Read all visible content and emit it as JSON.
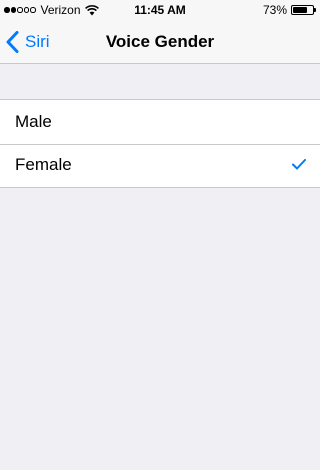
{
  "status_bar": {
    "carrier": "Verizon",
    "time": "11:45 AM",
    "battery_percent": "73%",
    "battery_level": 0.73,
    "signal_bars_filled": 2,
    "signal_bars_total": 5
  },
  "nav": {
    "back_label": "Siri",
    "title": "Voice Gender"
  },
  "options": [
    {
      "label": "Male",
      "selected": false
    },
    {
      "label": "Female",
      "selected": true
    }
  ],
  "colors": {
    "accent": "#007aff",
    "background": "#efeff4",
    "separator": "#c8c7cc"
  }
}
